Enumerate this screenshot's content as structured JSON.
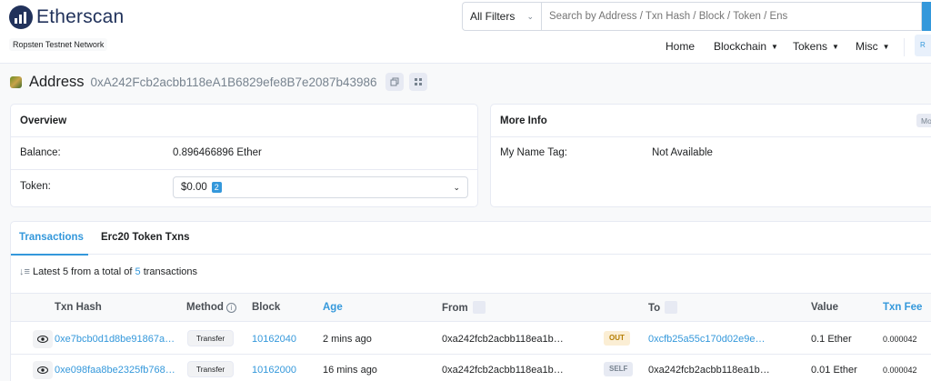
{
  "header": {
    "logo_text": "Etherscan",
    "network": "Ropsten Testnet Network",
    "search": {
      "filter_label": "All Filters",
      "placeholder": "Search by Address / Txn Hash / Block / Token / Ens"
    },
    "nav": [
      {
        "label": "Home"
      },
      {
        "label": "Blockchain"
      },
      {
        "label": "Tokens"
      },
      {
        "label": "Misc"
      }
    ],
    "nav_button_label": "R"
  },
  "address": {
    "label": "Address",
    "hash": "0xA242Fcb2acbb118eA1B6829efe8B7e2087b43986"
  },
  "overview": {
    "title": "Overview",
    "balance_label": "Balance:",
    "balance_value": "0.896466896 Ether",
    "token_label": "Token:",
    "token_value": "$0.00",
    "token_count": "2"
  },
  "more_info": {
    "title": "More Info",
    "more_button": "Mo",
    "name_tag_label": "My Name Tag:",
    "name_tag_value": "Not Available"
  },
  "transactions": {
    "tabs": [
      {
        "label": "Transactions"
      },
      {
        "label": "Erc20 Token Txns"
      }
    ],
    "summary_prefix": "Latest 5 from a total of",
    "summary_count": "5",
    "summary_suffix": "transactions",
    "columns": {
      "txn_hash": "Txn Hash",
      "method": "Method",
      "block": "Block",
      "age": "Age",
      "from": "From",
      "to": "To",
      "value": "Value",
      "txn_fee": "Txn Fee"
    },
    "rows": [
      {
        "hash": "0xe7bcb0d1d8be91867a…",
        "method": "Transfer",
        "block": "10162040",
        "age": "2 mins ago",
        "from": "0xa242fcb2acbb118ea1b…",
        "direction": "OUT",
        "to": "0xcfb25a55c170d02e9e…",
        "value": "0.1 Ether",
        "fee": "0.000042"
      },
      {
        "hash": "0xe098faa8be2325fb768…",
        "method": "Transfer",
        "block": "10162000",
        "age": "16 mins ago",
        "from": "0xa242fcb2acbb118ea1b…",
        "direction": "SELF",
        "to": "0xa242fcb2acbb118ea1b…",
        "value": "0.01 Ether",
        "fee": "0.000042"
      }
    ]
  },
  "colors": {
    "brand_navy": "#21325b",
    "link_blue": "#3498db",
    "out_badge": "#fbeed4",
    "self_badge": "#e7eaf3"
  },
  "icons": [
    "etherscan-logo-icon",
    "chevron-down-icon",
    "copy-icon",
    "qr-code-icon",
    "sort-icon",
    "filter-icon",
    "info-icon",
    "eye-icon"
  ]
}
